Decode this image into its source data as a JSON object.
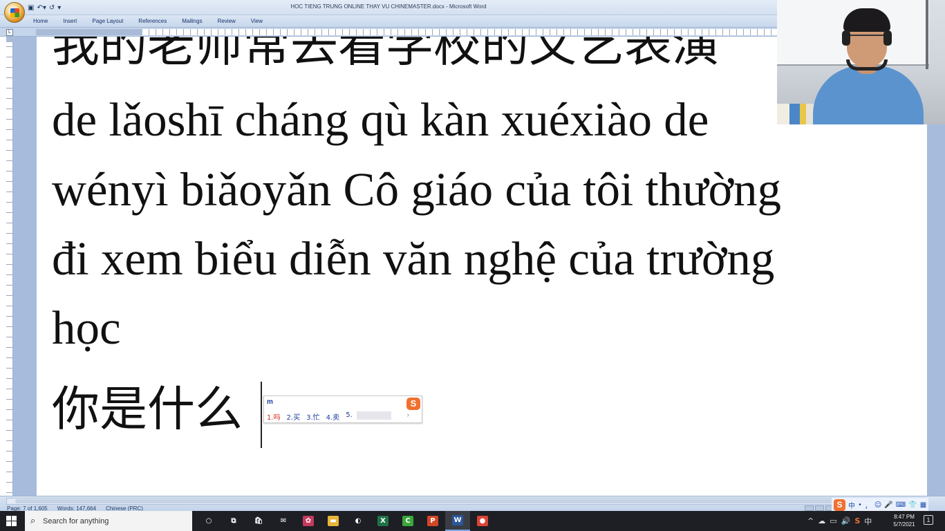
{
  "window": {
    "title": "HOC TIENG TRUNG ONLINE THAY VU CHINEMASTER.docx - Microsoft Word"
  },
  "quick_access": {
    "save_icon": "save-icon",
    "undo_icon": "undo-icon",
    "redo_icon": "redo-icon",
    "customize_icon": "chevron-down-icon"
  },
  "ribbon": {
    "tabs": [
      {
        "label": "Home"
      },
      {
        "label": "Insert"
      },
      {
        "label": "Page Layout"
      },
      {
        "label": "References"
      },
      {
        "label": "Mailings"
      },
      {
        "label": "Review"
      },
      {
        "label": "View"
      }
    ]
  },
  "ruler": {
    "corner_label": "L"
  },
  "document": {
    "lines": [
      "我的老师常去看学校的文艺表演",
      "de lǎoshī cháng qù kàn xuéxiào de",
      "wényì biǎoyǎn Cô giáo của tôi thường",
      "đi xem biểu diễn văn nghệ của trường",
      "học",
      "你是什么"
    ]
  },
  "ime": {
    "composition": "m",
    "candidates": [
      {
        "label": "1.吗"
      },
      {
        "label": "2.买"
      },
      {
        "label": "3.忙"
      },
      {
        "label": "4.卖"
      },
      {
        "label": "5."
      }
    ],
    "next_arrow": "›",
    "logo": "S"
  },
  "statusbar": {
    "page": "Page: 7 of 1,605",
    "words": "Words: 147,664",
    "language": "Chinese (PRC)"
  },
  "sogou_bar": {
    "logo": "S",
    "items": [
      "中",
      "•",
      "，",
      "☺",
      "🎤",
      "⌨",
      "👕",
      "▦"
    ]
  },
  "taskbar": {
    "search_placeholder": "Search for anything",
    "apps": [
      {
        "name": "cortana-icon",
        "glyph": "○",
        "color": "#1d1f24"
      },
      {
        "name": "task-view-icon",
        "glyph": "⧉",
        "color": "#1d1f24"
      },
      {
        "name": "store-icon",
        "glyph": "🛍",
        "color": "#1d1f24"
      },
      {
        "name": "mail-icon",
        "glyph": "✉",
        "color": "#1d1f24"
      },
      {
        "name": "app-icon",
        "glyph": "✿",
        "color": "#c43a5e"
      },
      {
        "name": "file-explorer-icon",
        "glyph": "▬",
        "color": "#e8b43a"
      },
      {
        "name": "media-icon",
        "glyph": "◐",
        "color": "#1d1f24"
      },
      {
        "name": "excel-icon",
        "glyph": "X",
        "color": "#207245"
      },
      {
        "name": "camtasia-icon",
        "glyph": "C",
        "color": "#3aa83a"
      },
      {
        "name": "powerpoint-icon",
        "glyph": "P",
        "color": "#d24726"
      },
      {
        "name": "word-icon",
        "glyph": "W",
        "color": "#2b579a"
      },
      {
        "name": "chrome-icon",
        "glyph": "●",
        "color": "#db4437"
      }
    ],
    "tray_icons": [
      "^",
      "☁",
      "▭",
      "🔊",
      "S",
      "中"
    ],
    "time": "8:47 PM",
    "date": "5/7/2021",
    "notification_count": "1"
  }
}
